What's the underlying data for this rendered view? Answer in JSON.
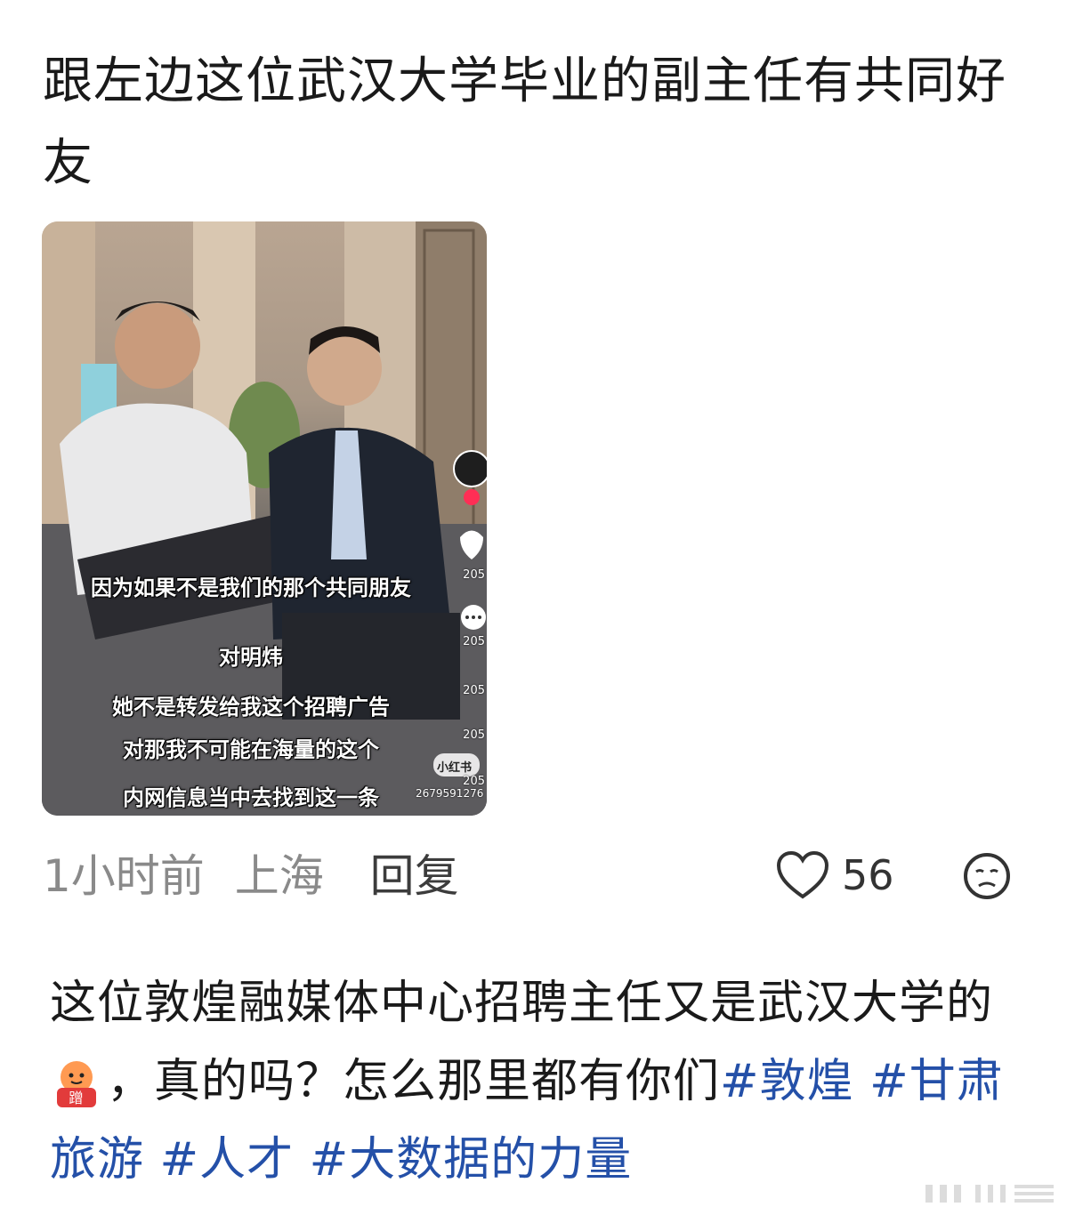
{
  "comment": {
    "text": "跟左边这位武汉大学毕业的副主任有共同好友"
  },
  "video": {
    "subtitles": [
      "因为如果不是我们的那个共同朋友",
      "对明炜",
      "她不是转发给我这个招聘广告",
      "对那我不可能在海量的这个",
      "内网信息当中去找到这一条"
    ],
    "side_counts": [
      "205",
      "205",
      "205",
      "205",
      "205"
    ],
    "watermark_logo": "小红书",
    "watermark_id": "2679591276"
  },
  "meta": {
    "time": "1小时前",
    "location": "上海",
    "reply_label": "回复",
    "like_count": "56"
  },
  "post": {
    "text_line1": "这位敦煌融媒体中心招聘主任又是武汉大学的",
    "text_line2_rest": "，真的吗？怎么那里都有你们",
    "hashtags": [
      "#敦煌",
      "#甘肃旅游",
      "#人才",
      "#大数据的力量"
    ],
    "emoji_name": "蹭-sticker-emoji"
  },
  "colors": {
    "hashtag": "#2450a8",
    "meta_gray": "#8a8a8a",
    "text": "#1a1a1a"
  }
}
